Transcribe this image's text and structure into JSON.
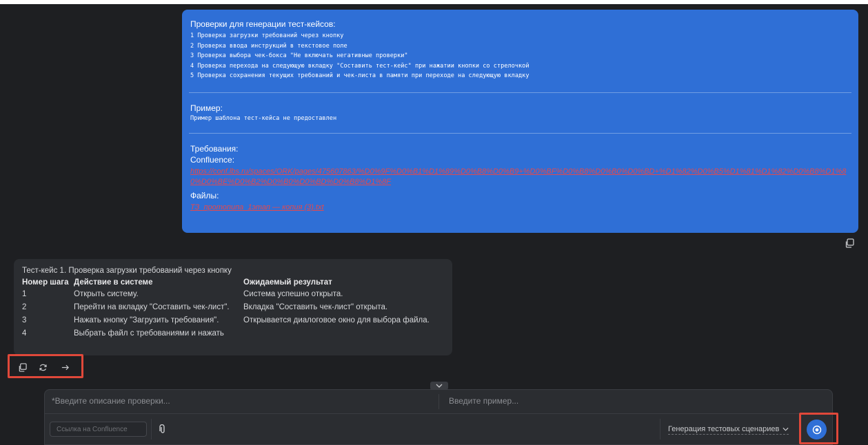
{
  "user_message": {
    "checks_heading": "Проверки для генерации тест-кейсов:",
    "checks": [
      "1 Проверка загрузки требований через кнопку",
      "2 Проверка ввода инструкций в текстовое поле",
      "3 Проверка выбора чек-бокса \"Не включать негативные проверки\"",
      "4 Проверка перехода на следующую вкладку \"Составить тест-кейс\" при нажатии кнопки со стрелочкой",
      "5 Проверка сохранения текущих требований и чек-листа в памяти при переходе на следующую вкладку"
    ],
    "example_heading": "Пример:",
    "example_text": "Пример шаблона тест-кейса не предоставлен",
    "requirements_heading": "Требования:",
    "confluence_label": "Confluence:",
    "confluence_link": "https://conf.lbs.ru/spaces/ORK/pages/475607863/%D0%9F%D0%B1%D1%89%D0%B8%D0%B9+%D0%BF%D0%B8%D0%B0%D0%BD+%D1%82%D0%B5%D1%81%D1%82%D0%B8%D1%80%D0%BE%D0%B2%D0%B0%D0%BD%D0%B8%D1%8F",
    "files_label": "Файлы:",
    "file_link": "ТЗ_протопипа_1этап — копия (3).txt"
  },
  "assistant_message": {
    "title": "Тест-кейс 1. Проверка загрузки требований через кнопку",
    "columns": [
      "Номер шага",
      "Действие в системе",
      "Ожидаемый результат"
    ],
    "rows": [
      [
        "1",
        "Открыть систему.",
        "Система успешно открыта."
      ],
      [
        "2",
        "Перейти на вкладку \"Составить чек-лист\".",
        "Вкладка \"Составить чек-лист\" открыта."
      ],
      [
        "3",
        "Нажать кнопку \"Загрузить требования\".",
        "Открывается диалоговое окно для выбора файла."
      ],
      [
        "4",
        "Выбрать файл с требованиями и нажать",
        ""
      ]
    ]
  },
  "composer": {
    "description_placeholder": "*Введите описание проверки...",
    "example_placeholder": "Введите пример...",
    "confluence_placeholder": "Ссылка на Confluence",
    "mode_label": "Генерация тестовых сценариев"
  },
  "icons": {
    "copy": "copy-icon",
    "regenerate": "refresh-icon",
    "next": "arrow-right-icon",
    "attach": "paperclip-icon",
    "send": "record-icon",
    "expand": "chevron-down-icon"
  },
  "colors": {
    "background": "#1e1f22",
    "user_bubble": "#2f6fd6",
    "assistant_bubble": "#2b2d31",
    "link": "#e5484d",
    "highlight": "#e0483a"
  }
}
